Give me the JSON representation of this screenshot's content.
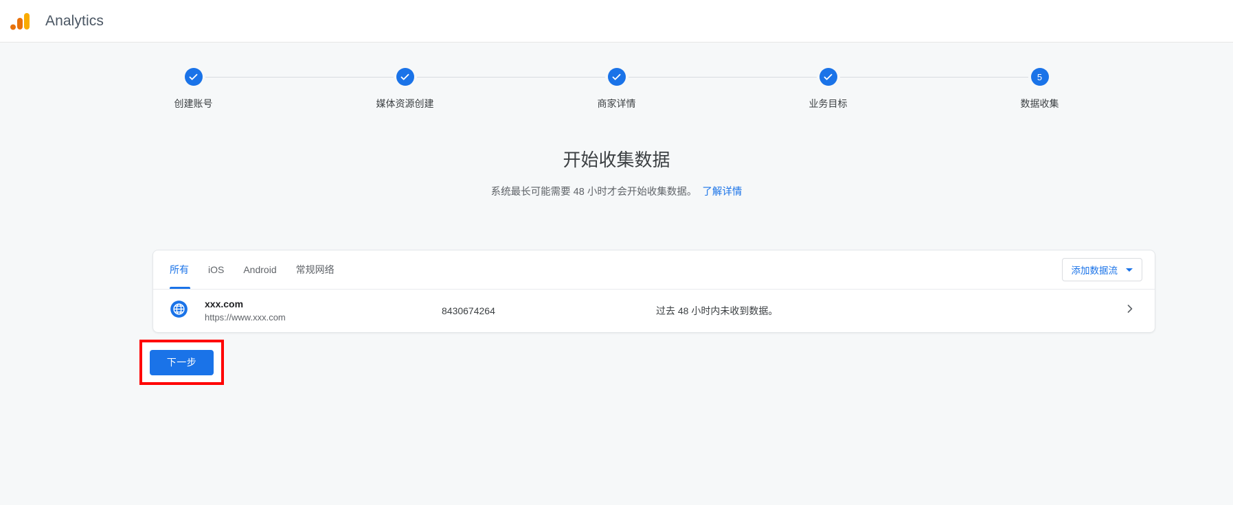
{
  "header": {
    "app_title": "Analytics",
    "logo_icon": "google-analytics-logo",
    "logo_colors": {
      "bar_dark": "#e8710a",
      "bar_light": "#f9ab00"
    }
  },
  "theme": {
    "accent": "#1a73e8",
    "page_bg": "#f6f8f9",
    "annotation": "#ff0000"
  },
  "stepper": {
    "steps": [
      {
        "label": "创建账号",
        "state": "complete",
        "marker": "check"
      },
      {
        "label": "媒体资源创建",
        "state": "complete",
        "marker": "check"
      },
      {
        "label": "商家详情",
        "state": "complete",
        "marker": "check"
      },
      {
        "label": "业务目标",
        "state": "complete",
        "marker": "check"
      },
      {
        "label": "数据收集",
        "state": "current",
        "marker": "5"
      }
    ]
  },
  "main": {
    "title": "开始收集数据",
    "subtitle": "系统最长可能需要 48 小时才会开始收集数据。",
    "subtitle_link": "了解详情",
    "tabs": [
      {
        "label": "所有",
        "active": true
      },
      {
        "label": "iOS",
        "active": false
      },
      {
        "label": "Android",
        "active": false
      },
      {
        "label": "常规网络",
        "active": false
      }
    ],
    "add_stream_button": "添加数据流",
    "streams": [
      {
        "icon": "globe-icon",
        "name": "xxx.com",
        "url": "https://www.xxx.com",
        "id": "8430674264",
        "status": "过去 48 小时内未收到数据。",
        "chevron": "›"
      }
    ],
    "next_button": "下一步"
  }
}
